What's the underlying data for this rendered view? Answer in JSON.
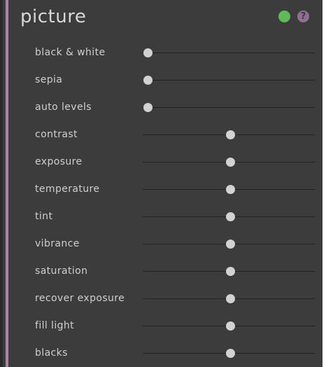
{
  "panel": {
    "title": "picture",
    "accent_color": "#a986a3",
    "status_icon": "green-dot-icon",
    "status_color": "#61b95a",
    "help_icon": "question-mark-icon",
    "help_glyph": "?",
    "help_color": "#8f6f93"
  },
  "sliders": [
    {
      "label": "black & white",
      "value": 0.0,
      "kind": "toggle"
    },
    {
      "label": "sepia",
      "value": 0.0,
      "kind": "toggle"
    },
    {
      "label": "auto levels",
      "value": 0.0,
      "kind": "toggle"
    },
    {
      "label": "contrast",
      "value": 0.5,
      "kind": "centered"
    },
    {
      "label": "exposure",
      "value": 0.5,
      "kind": "centered"
    },
    {
      "label": "temperature",
      "value": 0.5,
      "kind": "centered"
    },
    {
      "label": "tint",
      "value": 0.5,
      "kind": "centered"
    },
    {
      "label": "vibrance",
      "value": 0.5,
      "kind": "centered"
    },
    {
      "label": "saturation",
      "value": 0.5,
      "kind": "centered"
    },
    {
      "label": "recover exposure",
      "value": 0.5,
      "kind": "centered"
    },
    {
      "label": "fill light",
      "value": 0.5,
      "kind": "centered"
    },
    {
      "label": "blacks",
      "value": 0.5,
      "kind": "centered"
    }
  ]
}
